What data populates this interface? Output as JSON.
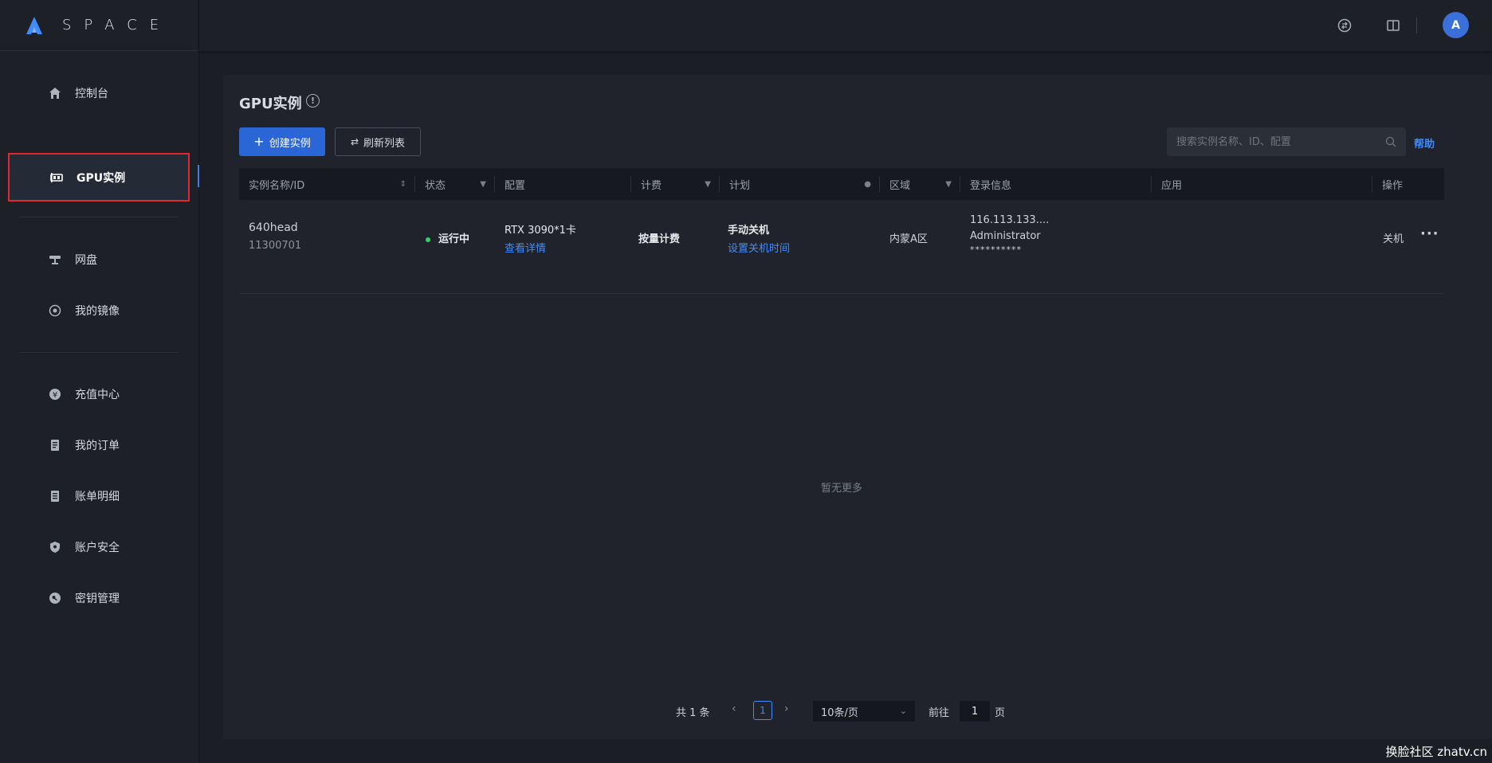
{
  "app": {
    "logo_text": "SPACE"
  },
  "sidebar": {
    "items": [
      {
        "label": "控制台",
        "icon": "home-icon"
      },
      {
        "label": "GPU实例",
        "icon": "gpu-icon",
        "active": true
      },
      {
        "label": "网盘",
        "icon": "disk-icon"
      },
      {
        "label": "我的镜像",
        "icon": "image-icon"
      },
      {
        "label": "充值中心",
        "icon": "yuan-icon"
      },
      {
        "label": "我的订单",
        "icon": "order-icon"
      },
      {
        "label": "账单明细",
        "icon": "bill-icon"
      },
      {
        "label": "账户安全",
        "icon": "shield-icon"
      },
      {
        "label": "密钥管理",
        "icon": "key-icon"
      }
    ]
  },
  "header": {
    "avatar_initial": "A"
  },
  "page": {
    "title": "GPU实例",
    "create_button": "创建实例",
    "refresh_button": "刷新列表",
    "search_placeholder": "搜索实例名称、ID、配置",
    "help_link": "帮助"
  },
  "table": {
    "columns": [
      "实例名称/ID",
      "状态",
      "配置",
      "计费",
      "计划",
      "区域",
      "登录信息",
      "应用",
      "操作"
    ],
    "rows": [
      {
        "name": "640head",
        "id": "11300701",
        "status": "运行中",
        "config": "RTX 3090*1卡",
        "config_link": "查看详情",
        "billing": "按量计费",
        "plan": "手动关机",
        "plan_link": "设置关机时间",
        "region": "内蒙A区",
        "login_ip": "116.113.133....",
        "login_user": "Administrator",
        "login_password": "**********",
        "app": "",
        "action": "关机"
      }
    ],
    "empty_text": "暂无更多"
  },
  "pagination": {
    "total": "共 1 条",
    "current_page": "1",
    "page_size": "10条/页",
    "goto_label": "前往",
    "goto_value": "1",
    "page_suffix": "页"
  },
  "watermark": "换脸社区 zhatv.cn",
  "colors": {
    "accent": "#2a66d6",
    "link": "#3f8cff",
    "status_running": "#2fd36a",
    "highlight_border": "#e0282e"
  }
}
